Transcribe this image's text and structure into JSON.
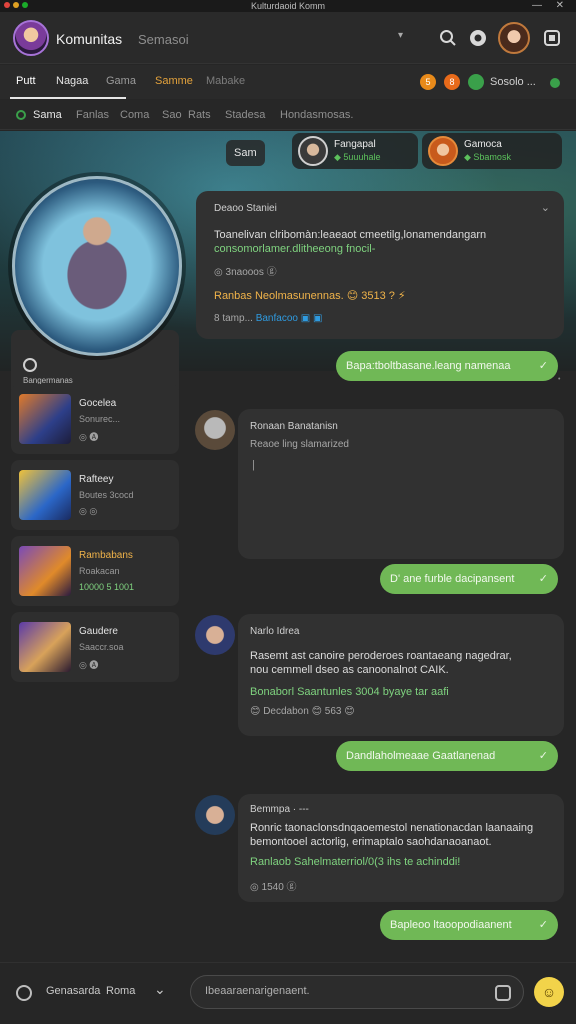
{
  "window": {
    "title": "Kulturdaoid Komm",
    "min_glyph": "—",
    "close_glyph": "✕",
    "traffic_colors": [
      "#e0443e",
      "#dea123",
      "#1aab29"
    ]
  },
  "header": {
    "app_name": "Komunitas",
    "search_placeholder": "Semasoi",
    "chevron": "▾"
  },
  "tabs": {
    "items": [
      "Putt",
      "Nagaa",
      "Gama",
      "Samme",
      "Mabake"
    ],
    "active_index": 0,
    "chips": [
      {
        "label": "5",
        "color": "#e88a1a"
      },
      {
        "label": "8",
        "color": "#e86a1a"
      },
      {
        "label": "",
        "color": "#3aa04a"
      }
    ],
    "status_text": "Sosolo ..."
  },
  "subtabs": {
    "items": [
      "Sama",
      "Fanlas",
      "Coma",
      "Sao",
      "Rats",
      "Stadesa",
      "Hondasmosas."
    ],
    "active_index": 0
  },
  "banner": {
    "center_label": "Sam",
    "friends": [
      {
        "name": "Fangapal",
        "status": "◆ 5uuuhale"
      },
      {
        "name": "Gamoca",
        "status": "◆ Sbamosk"
      }
    ]
  },
  "left_panel": {
    "title": "Bangermanas",
    "cards": [
      {
        "title": "Gocelea",
        "sub": "Sonurec...",
        "meta": "◎ 🅐"
      },
      {
        "title": "Rafteey",
        "sub": "Boutes 3cocd",
        "meta": "◎ ◎"
      },
      {
        "title": "Rambabans",
        "sub": "Roakacan",
        "meta": "10000 5 1001"
      },
      {
        "title": "Gaudere",
        "sub": "Saaccr.soa",
        "meta": "◎ 🅐"
      }
    ]
  },
  "messages": {
    "top_panel": {
      "header": "Deaoo Staniei",
      "line1": "Toanelivan clribomàn:leaeaot cmeetilg,lonamendangarn",
      "line2": "consomorlamer.dlitheeong fnocil-",
      "line3": "◎ 3naooos ⓖ",
      "line4": "Ranbas  Neolmasunennas. 😊 3513 ? ⚡",
      "line5_pre": "8 tamp... ",
      "line5_link": "Banfacoo",
      "line5_post": " ▣ ▣"
    },
    "bubble1": "Bapa:tboltbasane.leang namenaa",
    "panel2": {
      "header": "Ronaan Banatanisn",
      "sub": "Reaoe ling slamarized",
      "cursor": "|"
    },
    "bubble2": "D' ane furble dacipansent",
    "panel3": {
      "header": "Narlo Idrea",
      "line1": "Rasemt ast canoire peroderoes roantaeang nagedrar,",
      "line2": "nou cemmell dseo as canoonalnot CAIK.",
      "line3": "Bonaborl Saantunles 3004 byaye tar aafi",
      "line4": "😊 Decdabon 😊 563 😊"
    },
    "bubble3": "Dandlaholmeaae Gaatlanenad",
    "panel4": {
      "header": "Bemmpa · ---",
      "line1": "Ronric taonaclonsdnqaoemestol nenationacdan laanaaing",
      "line2": "bemontooel actorlig, erimaptalo saohdanaoanaot.",
      "line3": "Ranlaob Sahelmaterriol/0(3 ihs te achinddi!",
      "line4": "◎ 1540 ⓖ"
    },
    "bubble4": "Bapleoo ltaoopodiaanent",
    "check": "✓"
  },
  "composer": {
    "label1": "Genasarda",
    "label2": "Roma",
    "chevron": "⌄",
    "placeholder": "Ibeaaraenarigenaent.",
    "emoji": "☺"
  }
}
